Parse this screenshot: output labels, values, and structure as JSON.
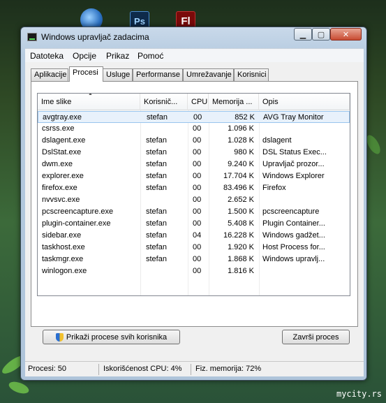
{
  "desktop": {
    "icons": [
      {
        "name": "globe-icon",
        "label": ""
      },
      {
        "name": "photoshop-icon",
        "label": "Ps"
      },
      {
        "name": "flash-icon",
        "label": "Fl"
      }
    ],
    "watermark": "mycity.rs"
  },
  "window": {
    "title": "Windows upravljač zadacima",
    "controls": {
      "minimize": "▁",
      "maximize": "▢",
      "close": "✕"
    }
  },
  "menu": [
    "Datoteka",
    "Opcije",
    "Prikaz",
    "Pomoć"
  ],
  "tabs": [
    {
      "label": "Aplikacije"
    },
    {
      "label": "Procesi",
      "active": true
    },
    {
      "label": "Usluge"
    },
    {
      "label": "Performanse"
    },
    {
      "label": "Umrežavanje"
    },
    {
      "label": "Korisnici"
    }
  ],
  "columns": [
    "Ime slike",
    "Korisnič...",
    "CPU",
    "Memorija ...",
    "Opis"
  ],
  "processes": [
    {
      "name": "avgtray.exe",
      "user": "stefan",
      "cpu": "00",
      "mem": "852 K",
      "desc": "AVG Tray Monitor",
      "selected": true
    },
    {
      "name": "csrss.exe",
      "user": "",
      "cpu": "00",
      "mem": "1.096 K",
      "desc": ""
    },
    {
      "name": "dslagent.exe",
      "user": "stefan",
      "cpu": "00",
      "mem": "1.028 K",
      "desc": "dslagent"
    },
    {
      "name": "DslStat.exe",
      "user": "stefan",
      "cpu": "00",
      "mem": "980 K",
      "desc": "DSL Status Exec..."
    },
    {
      "name": "dwm.exe",
      "user": "stefan",
      "cpu": "00",
      "mem": "9.240 K",
      "desc": "Upravljač prozor..."
    },
    {
      "name": "explorer.exe",
      "user": "stefan",
      "cpu": "00",
      "mem": "17.704 K",
      "desc": "Windows Explorer"
    },
    {
      "name": "firefox.exe",
      "user": "stefan",
      "cpu": "00",
      "mem": "83.496 K",
      "desc": "Firefox"
    },
    {
      "name": "nvvsvc.exe",
      "user": "",
      "cpu": "00",
      "mem": "2.652 K",
      "desc": ""
    },
    {
      "name": "pcscreencapture.exe",
      "user": "stefan",
      "cpu": "00",
      "mem": "1.500 K",
      "desc": "pcscreencapture"
    },
    {
      "name": "plugin-container.exe",
      "user": "stefan",
      "cpu": "00",
      "mem": "5.408 K",
      "desc": "Plugin Container..."
    },
    {
      "name": "sidebar.exe",
      "user": "stefan",
      "cpu": "04",
      "mem": "16.228 K",
      "desc": "Windows gadžet..."
    },
    {
      "name": "taskhost.exe",
      "user": "stefan",
      "cpu": "00",
      "mem": "1.920 K",
      "desc": "Host Process for..."
    },
    {
      "name": "taskmgr.exe",
      "user": "stefan",
      "cpu": "00",
      "mem": "1.868 K",
      "desc": "Windows upravlj..."
    },
    {
      "name": "winlogon.exe",
      "user": "",
      "cpu": "00",
      "mem": "1.816 K",
      "desc": ""
    }
  ],
  "buttons": {
    "show_all": "Prikaži procese svih korisnika",
    "end_process": "Završi proces"
  },
  "status": {
    "processes": "Procesi: 50",
    "cpu": "Iskorišćenost CPU: 4%",
    "memory": "Fiz. memorija: 72%"
  }
}
